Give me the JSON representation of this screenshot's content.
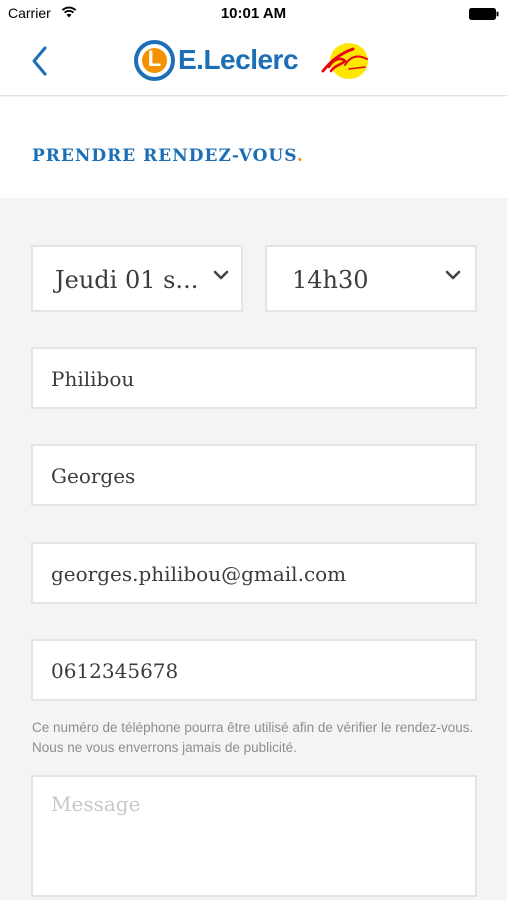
{
  "status_bar": {
    "carrier": "Carrier",
    "time": "10:01 AM"
  },
  "nav": {
    "logo_letter": "L",
    "logo_text": "E.Leclerc"
  },
  "page": {
    "title": "PRENDRE RENDEZ-VOUS",
    "title_dot": "."
  },
  "form": {
    "date_select": "Jeudi 01 s...",
    "time_select": "14h30",
    "last_name": "Philibou",
    "first_name": "Georges",
    "email": "georges.philibou@gmail.com",
    "phone": "0612345678",
    "phone_hint": "Ce numéro de téléphone pourra être utilisé afin de vérifier le rendez-vous. Nous ne vous enverrons jamais de publicité.",
    "message_placeholder": "Message"
  },
  "colors": {
    "brand_blue": "#1c6fb6",
    "brand_orange": "#f39200",
    "badge_yellow": "#ffe600",
    "badge_red": "#e30613"
  },
  "icons": {
    "back": "chevron-left-icon",
    "dropdown": "chevron-down-icon",
    "wifi": "wifi-icon",
    "battery": "battery-icon"
  }
}
